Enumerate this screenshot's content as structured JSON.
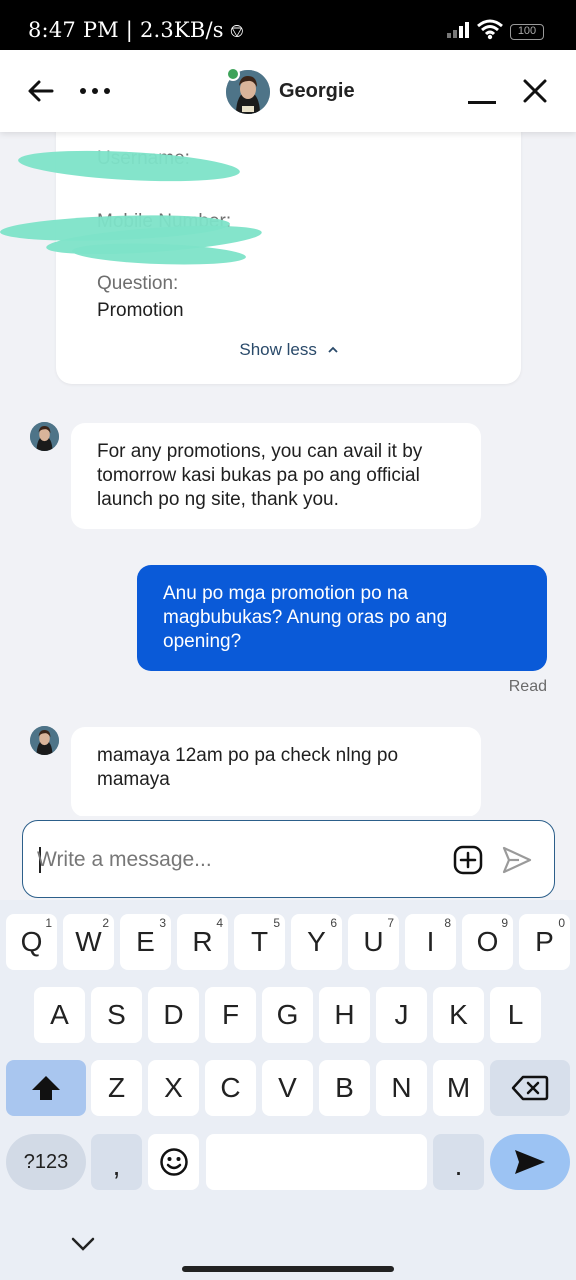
{
  "status_bar": {
    "time": "8:47 PM",
    "separator": "|",
    "speed": "2.3KB/s",
    "battery": "100"
  },
  "header": {
    "contact_name": "Georgie",
    "online": true
  },
  "info_card": {
    "fields": [
      {
        "label": "Username:",
        "value": ""
      },
      {
        "label": "Mobile Number:",
        "value": ""
      },
      {
        "label": "Question:",
        "value": "Promotion"
      }
    ],
    "toggle_label": "Show less"
  },
  "messages": [
    {
      "from": "agent",
      "text": "For any promotions, you can avail it by tomorrow kasi bukas pa po ang official launch po ng site, thank you."
    },
    {
      "from": "user",
      "text": "Anu po mga promotion po na magbubukas? Anung oras po ang opening?",
      "status": "Read"
    },
    {
      "from": "agent",
      "text": "mamaya 12am po pa check nlng po mamaya"
    }
  ],
  "composer": {
    "placeholder": "Write a message..."
  },
  "keyboard": {
    "row1": [
      {
        "k": "Q",
        "n": "1"
      },
      {
        "k": "W",
        "n": "2"
      },
      {
        "k": "E",
        "n": "3"
      },
      {
        "k": "R",
        "n": "4"
      },
      {
        "k": "T",
        "n": "5"
      },
      {
        "k": "Y",
        "n": "6"
      },
      {
        "k": "U",
        "n": "7"
      },
      {
        "k": "I",
        "n": "8"
      },
      {
        "k": "O",
        "n": "9"
      },
      {
        "k": "P",
        "n": "0"
      }
    ],
    "row2": [
      "A",
      "S",
      "D",
      "F",
      "G",
      "H",
      "J",
      "K",
      "L"
    ],
    "row3": [
      "Z",
      "X",
      "C",
      "V",
      "B",
      "N",
      "M"
    ],
    "symbols_label": "?123",
    "comma": ",",
    "period": ".",
    "icons": {
      "shift": "shift-icon",
      "backspace": "backspace-icon",
      "emoji": "emoji-icon",
      "send": "send-icon"
    }
  },
  "colors": {
    "accent": "#0a5ad8",
    "online_dot": "#3ea35a",
    "redaction": "#7de3c8"
  }
}
